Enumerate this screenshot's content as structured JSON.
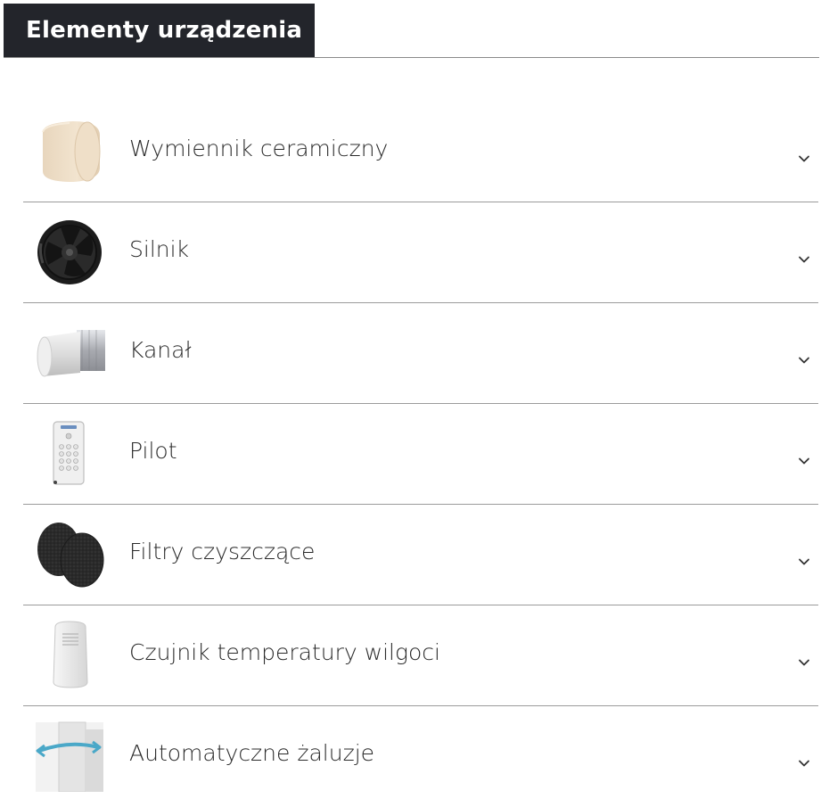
{
  "header": {
    "title": "Elementy urządzenia"
  },
  "colors": {
    "header_bg": "#23252b",
    "header_text": "#ffffff",
    "divider": "#9b9b9b",
    "text": "#2b2b2b"
  },
  "items": [
    {
      "label": "Wymiennik ceramiczny",
      "icon": "ceramic-exchanger-icon"
    },
    {
      "label": "Silnik",
      "icon": "fan-motor-icon"
    },
    {
      "label": "Kanał",
      "icon": "duct-pipe-icon"
    },
    {
      "label": "Pilot",
      "icon": "remote-control-icon"
    },
    {
      "label": "Filtry czyszczące",
      "icon": "filters-icon"
    },
    {
      "label": "Czujnik temperatury wilgoci",
      "icon": "sensor-icon"
    },
    {
      "label": "Automatyczne żaluzje",
      "icon": "shutters-icon"
    }
  ]
}
